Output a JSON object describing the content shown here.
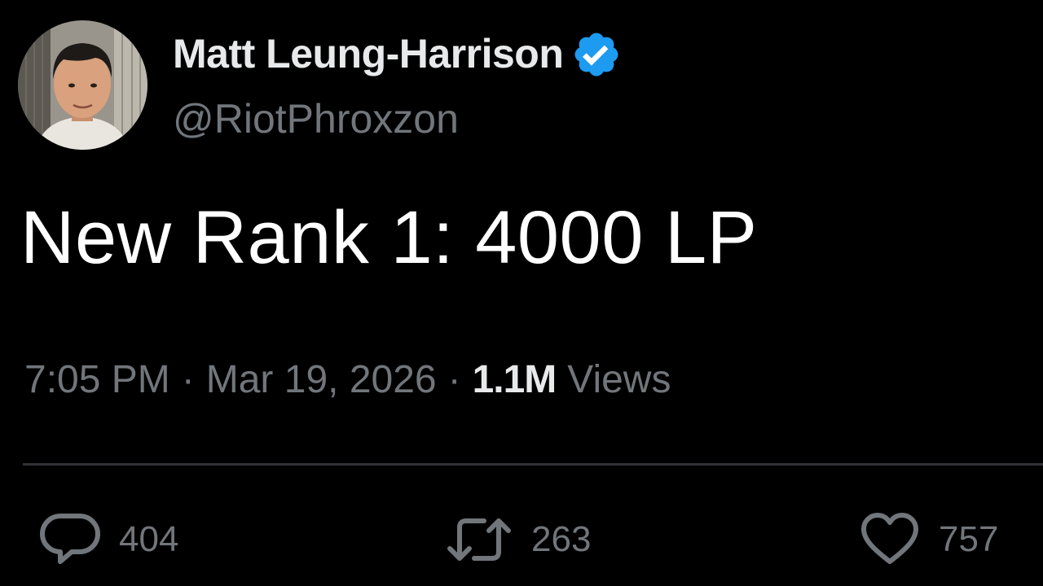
{
  "author": {
    "display_name": "Matt Leung-Harrison",
    "handle": "@RiotPhroxzon",
    "verified": true,
    "avatar_icon": "profile-photo",
    "verified_color": "#1d9bf0"
  },
  "tweet": {
    "text": "New Rank 1: 4000 LP"
  },
  "meta": {
    "time": "7:05 PM",
    "separator": "·",
    "date": "Mar 19, 2026",
    "views_count": "1.1M",
    "views_label": "Views"
  },
  "actions": {
    "reply": {
      "icon": "reply-icon",
      "count": "404"
    },
    "retweet": {
      "icon": "retweet-icon",
      "count": "263"
    },
    "like": {
      "icon": "heart-icon",
      "count": "757"
    }
  },
  "colors": {
    "background": "#000000",
    "primary_text": "#e7e9ea",
    "secondary_text": "#71767b",
    "divider": "#2f3336"
  }
}
